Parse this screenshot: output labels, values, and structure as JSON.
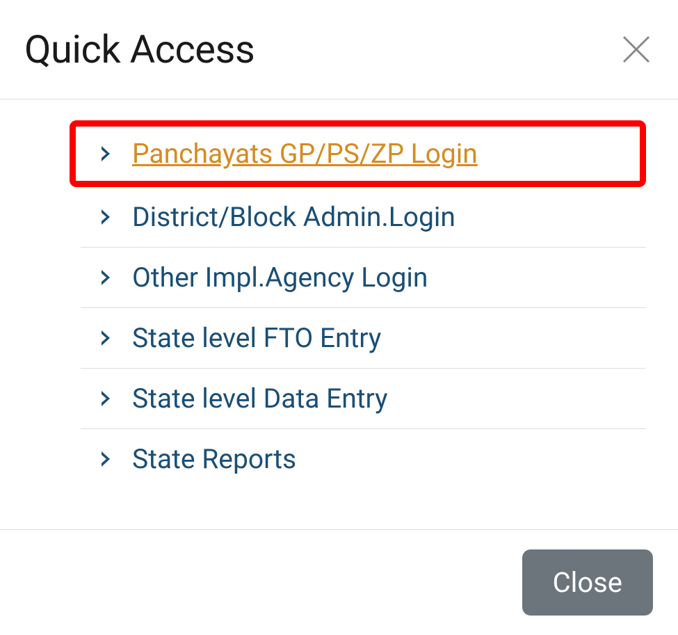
{
  "header": {
    "title": "Quick Access"
  },
  "menu": {
    "items": [
      {
        "label": "Panchayats GP/PS/ZP Login",
        "highlighted": true
      },
      {
        "label": "District/Block Admin.Login",
        "highlighted": false
      },
      {
        "label": "Other Impl.Agency Login",
        "highlighted": false
      },
      {
        "label": "State level FTO Entry",
        "highlighted": false
      },
      {
        "label": "State level Data Entry",
        "highlighted": false
      },
      {
        "label": "State Reports",
        "highlighted": false
      }
    ]
  },
  "footer": {
    "close_label": "Close"
  }
}
